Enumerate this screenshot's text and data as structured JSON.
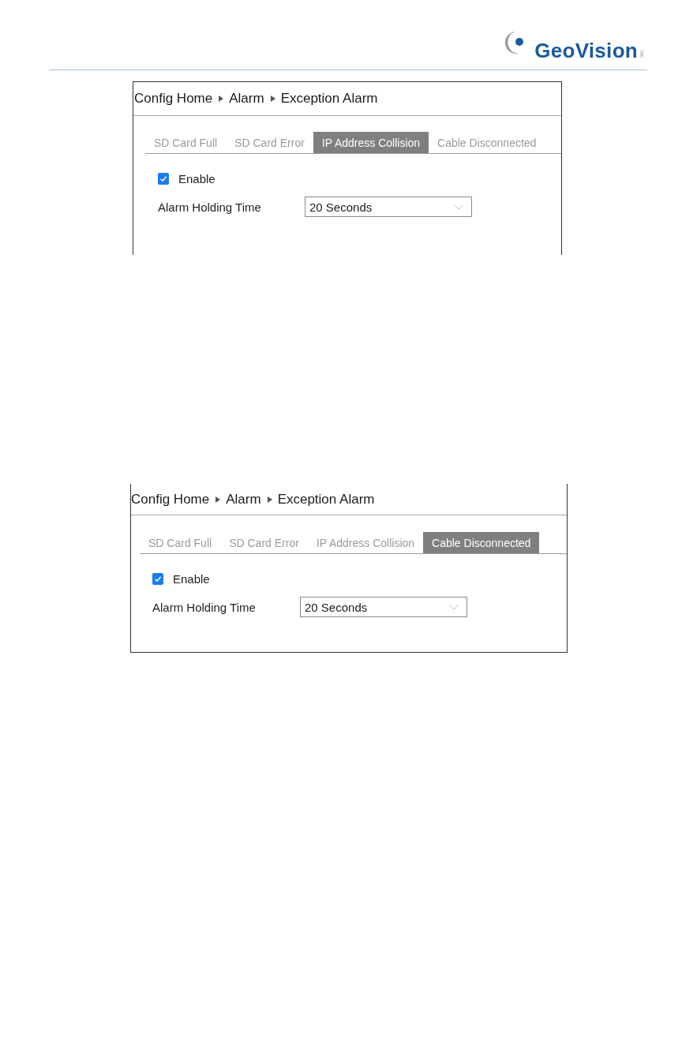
{
  "header": {
    "logo": {
      "name": "GeoVision",
      "suffix": "inc"
    }
  },
  "panels": [
    {
      "breadcrumb": [
        "Config Home",
        "Alarm",
        "Exception Alarm"
      ],
      "tabs": [
        {
          "label": "SD Card Full",
          "selected": false
        },
        {
          "label": "SD Card Error",
          "selected": false
        },
        {
          "label": "IP Address Collision",
          "selected": true
        },
        {
          "label": "Cable Disconnected",
          "selected": false
        }
      ],
      "enable": {
        "label": "Enable",
        "checked": true
      },
      "holding_time": {
        "label": "Alarm Holding Time",
        "value": "20 Seconds"
      }
    },
    {
      "breadcrumb": [
        "Config Home",
        "Alarm",
        "Exception Alarm"
      ],
      "tabs": [
        {
          "label": "SD Card Full",
          "selected": false
        },
        {
          "label": "SD Card Error",
          "selected": false
        },
        {
          "label": "IP Address Collision",
          "selected": false
        },
        {
          "label": "Cable Disconnected",
          "selected": true
        }
      ],
      "enable": {
        "label": "Enable",
        "checked": true
      },
      "holding_time": {
        "label": "Alarm Holding Time",
        "value": "20 Seconds"
      }
    }
  ]
}
